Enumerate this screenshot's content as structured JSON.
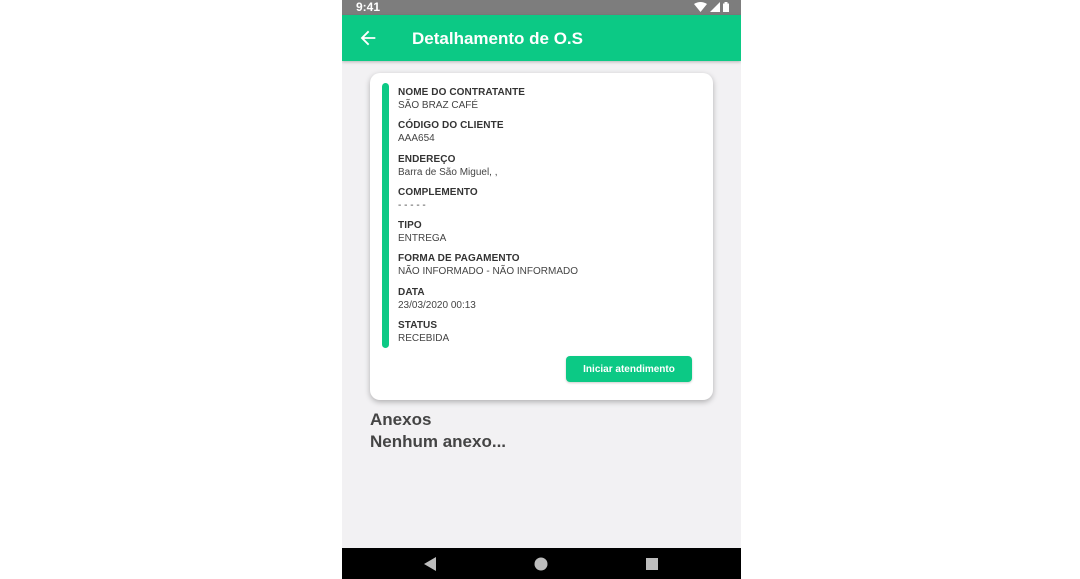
{
  "status_bar": {
    "time": "9:41"
  },
  "app_bar": {
    "title": "Detalhamento de O.S"
  },
  "card": {
    "fields": [
      {
        "label": "NOME DO CONTRATANTE",
        "value": "SÃO BRAZ CAFÉ"
      },
      {
        "label": "CÓDIGO DO CLIENTE",
        "value": "AAA654"
      },
      {
        "label": "ENDEREÇO",
        "value": "Barra de São Miguel, ,"
      },
      {
        "label": "COMPLEMENTO",
        "value": "- - - - -"
      },
      {
        "label": "TIPO",
        "value": "ENTREGA"
      },
      {
        "label": "FORMA DE PAGAMENTO",
        "value": "NÃO INFORMADO - NÃO INFORMADO"
      },
      {
        "label": "DATA",
        "value": "23/03/2020 00:13"
      },
      {
        "label": "STATUS",
        "value": "RECEBIDA"
      }
    ],
    "action_label": "Iniciar atendimento"
  },
  "attachments": {
    "title": "Anexos",
    "empty_text": "Nenhum anexo..."
  },
  "colors": {
    "accent": "#0cc985",
    "background": "#f2f1f3",
    "status_bar": "#7d7d7d"
  },
  "icons": [
    "wifi-icon",
    "signal-icon",
    "battery-icon",
    "back-arrow-icon",
    "nav-back-icon",
    "nav-home-icon",
    "nav-recents-icon"
  ]
}
